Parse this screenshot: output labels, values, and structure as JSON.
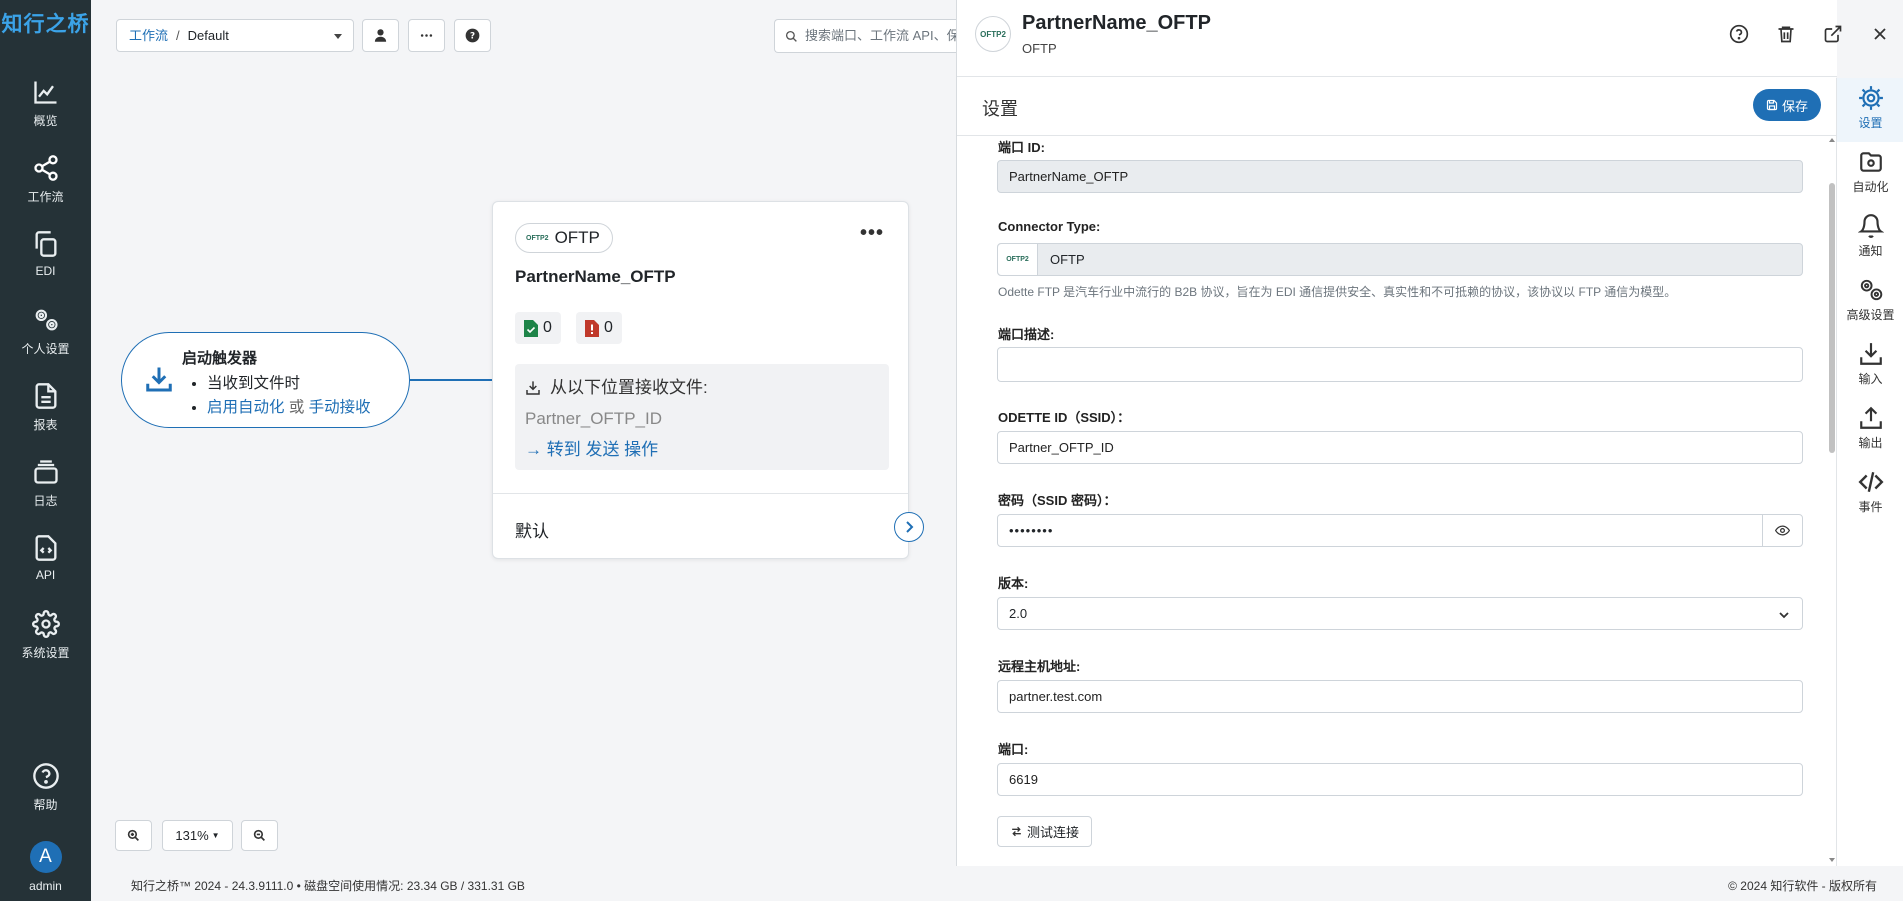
{
  "app": {
    "brand": "知行之桥",
    "colors": {
      "accent": "#1f6fb5",
      "nav_bg": "#253237",
      "brand_text": "#3ba3e8"
    }
  },
  "leftnav": {
    "items": [
      {
        "label": "概览",
        "icon": "chart-line-icon"
      },
      {
        "label": "工作流",
        "icon": "share-nodes-icon"
      },
      {
        "label": "EDI",
        "icon": "copy-icon"
      },
      {
        "label": "个人设置",
        "icon": "user-gears-icon"
      },
      {
        "label": "报表",
        "icon": "file-lines-icon"
      },
      {
        "label": "日志",
        "icon": "layers-icon"
      },
      {
        "label": "API",
        "icon": "file-code-icon"
      },
      {
        "label": "系统设置",
        "icon": "gear-icon"
      }
    ],
    "help_label": "帮助",
    "user": {
      "initial": "A",
      "name": "admin"
    }
  },
  "toolbar": {
    "breadcrumb": {
      "level1": "工作流",
      "level2": "Default"
    },
    "search_placeholder": "搜索端口、工作流 API、保"
  },
  "flow": {
    "trigger": {
      "title": "启动触发器",
      "line1": "当收到文件时",
      "link_auto": "启用自动化",
      "or": "或",
      "link_manual": "手动接收"
    },
    "card": {
      "type_label": "OFTP",
      "type_logo": "OFTP2",
      "name": "PartnerName_OFTP",
      "success_count": "0",
      "error_count": "0",
      "receive_label": "从以下位置接收文件:",
      "receive_value": "Partner_OFTP_ID",
      "goto_label": "转到 发送 操作",
      "default_label": "默认"
    }
  },
  "zoom": {
    "level": "131%"
  },
  "footer": {
    "left": "知行之桥™ 2024 - 24.3.9111.0  •  磁盘空间使用情况:  23.34 GB / 331.31 GB",
    "right": "© 2024 知行软件 - 版权所有"
  },
  "panel": {
    "logo": "OFTP2",
    "title": "PartnerName_OFTP",
    "subtitle": "OFTP",
    "section_title": "设置",
    "save_label": "保存",
    "fields": {
      "port_id_label": "端口 ID:",
      "port_id_value": "PartnerName_OFTP",
      "connector_type_label": "Connector Type:",
      "connector_type_logo": "OFTP2",
      "connector_type_value": "OFTP",
      "connector_help": "Odette FTP 是汽车行业中流行的 B2B 协议，旨在为 EDI 通信提供安全、真实性和不可抵赖的协议，该协议以 FTP 通信为模型。",
      "description_label": "端口描述:",
      "description_value": "",
      "odette_id_label": "ODETTE ID（SSID）：",
      "odette_id_value": "Partner_OFTP_ID",
      "password_label": "密码（SSID 密码）：",
      "password_value": "••••••••",
      "version_label": "版本:",
      "version_value": "2.0",
      "remote_host_label": "远程主机地址:",
      "remote_host_value": "partner.test.com",
      "port_label": "端口:",
      "port_value": "6619",
      "test_label": "测试连接"
    }
  },
  "rail": {
    "tabs": [
      {
        "label": "设置",
        "icon": "gears-icon",
        "active": true
      },
      {
        "label": "自动化",
        "icon": "folder-gear-icon"
      },
      {
        "label": "通知",
        "icon": "bell-icon"
      },
      {
        "label": "高级设置",
        "icon": "advanced-gears-icon"
      },
      {
        "label": "输入",
        "icon": "download-icon"
      },
      {
        "label": "输出",
        "icon": "upload-icon"
      },
      {
        "label": "事件",
        "icon": "code-icon"
      }
    ]
  }
}
